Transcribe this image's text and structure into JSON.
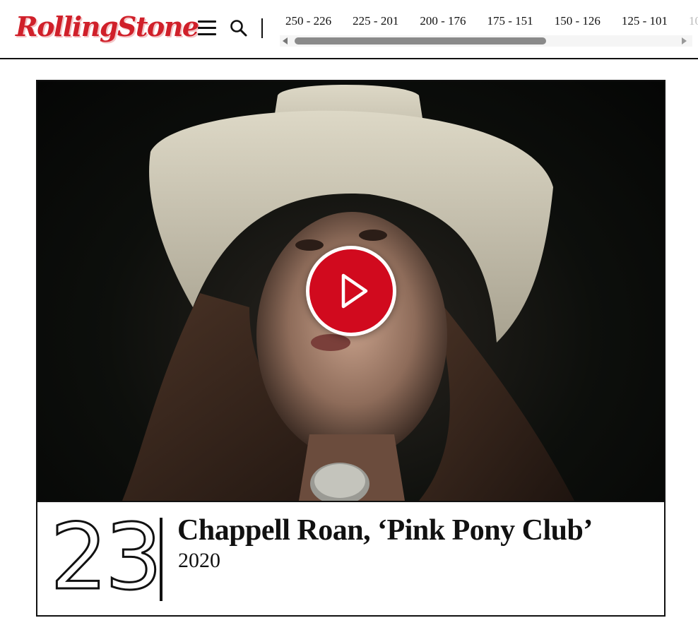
{
  "brand": {
    "logo_text": "RollingStone",
    "accent_color": "#d0202a"
  },
  "header": {
    "menu_icon": "hamburger-menu-icon",
    "search_icon": "search-icon",
    "ranges": [
      "250 - 226",
      "225 - 201",
      "200 - 176",
      "175 - 151",
      "150 - 126",
      "125 - 101",
      "10"
    ]
  },
  "entry": {
    "rank": "23",
    "title": "Chappell Roan, ‘Pink Pony Club’",
    "year": "2020",
    "play_icon": "play-icon",
    "play_button_color": "#d10a1e"
  }
}
